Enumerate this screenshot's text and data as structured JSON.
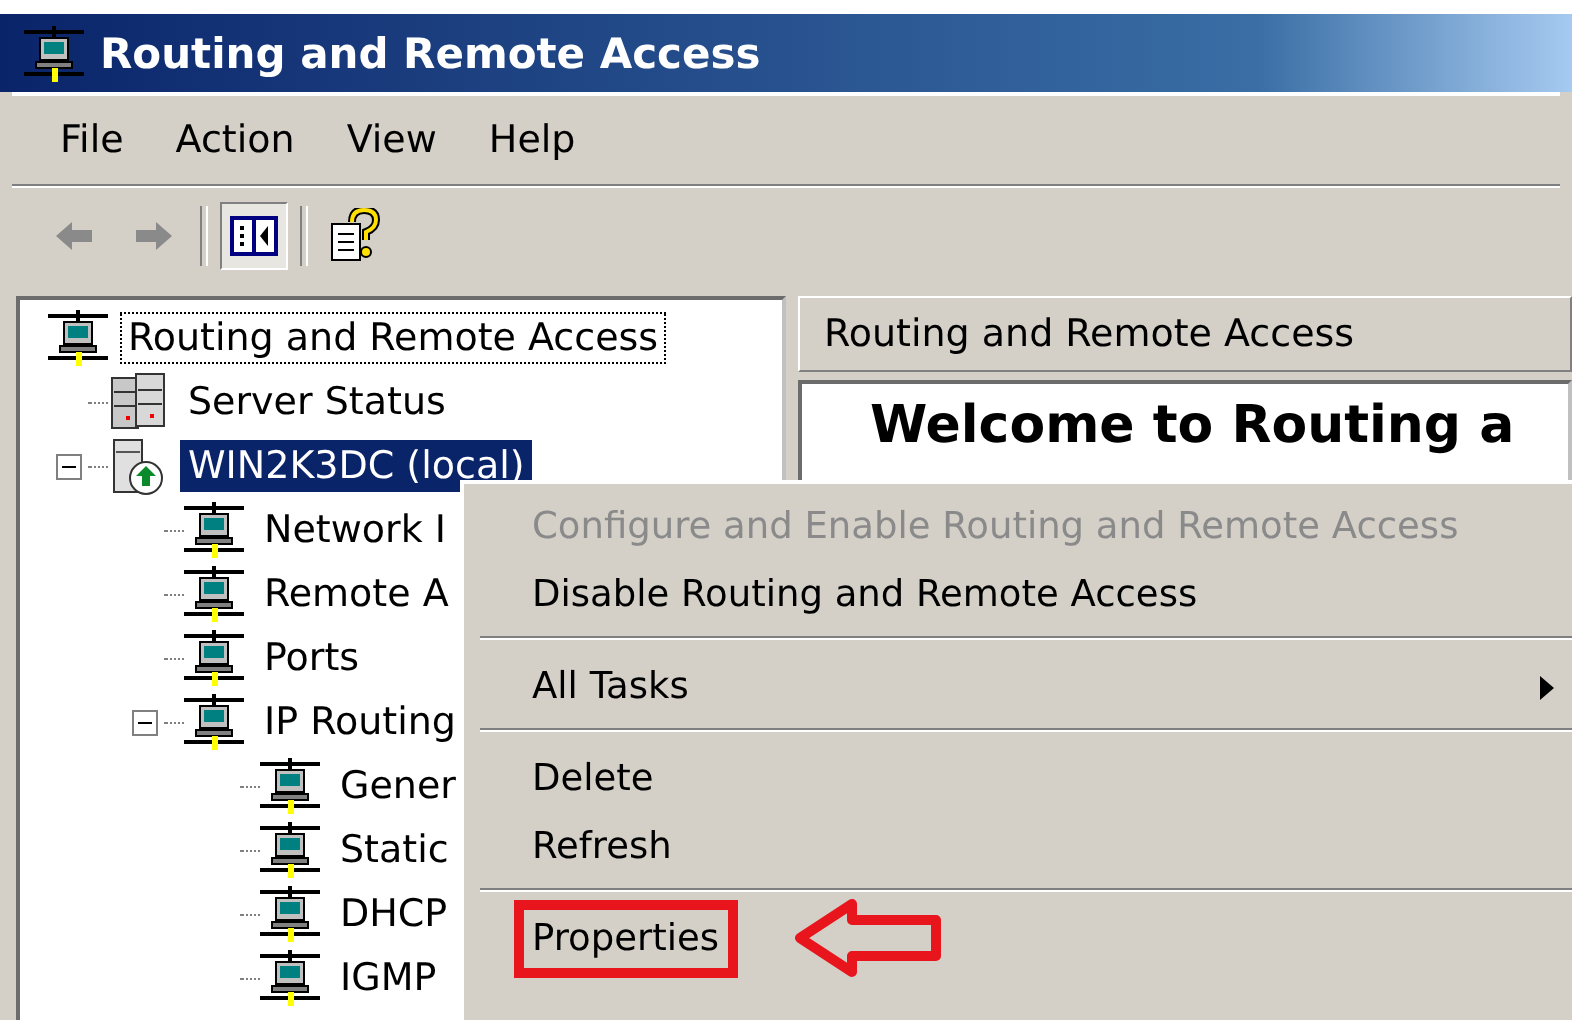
{
  "window": {
    "title": "Routing and Remote Access"
  },
  "menu_bar": [
    {
      "label": "File"
    },
    {
      "label": "Action"
    },
    {
      "label": "View"
    },
    {
      "label": "Help"
    }
  ],
  "toolbar": [
    {
      "kind": "back",
      "disabled": true
    },
    {
      "kind": "forward",
      "disabled": true
    },
    {
      "kind": "separator"
    },
    {
      "kind": "tree-toggle",
      "pressed": true
    },
    {
      "kind": "separator"
    },
    {
      "kind": "help"
    }
  ],
  "tree": [
    {
      "label": "Routing and Remote Access",
      "kind": "node",
      "selected": false,
      "focused": true,
      "children": [
        {
          "label": "Server Status",
          "kind": "status",
          "selected": false,
          "focused": false
        },
        {
          "label": "WIN2K3DC (local)",
          "kind": "server",
          "selected": true,
          "focused": false,
          "expanded": true,
          "children": [
            {
              "label": "Network I",
              "kind": "node",
              "selected": false,
              "focused": false
            },
            {
              "label": "Remote A",
              "kind": "node",
              "selected": false,
              "focused": false
            },
            {
              "label": "Ports",
              "kind": "node",
              "selected": false,
              "focused": false
            },
            {
              "label": "IP Routing",
              "kind": "node",
              "selected": false,
              "focused": false,
              "expanded": true,
              "children": [
                {
                  "label": "Gener",
                  "kind": "node",
                  "selected": false,
                  "focused": false
                },
                {
                  "label": "Static",
                  "kind": "node",
                  "selected": false,
                  "focused": false
                },
                {
                  "label": "DHCP",
                  "kind": "node",
                  "selected": false,
                  "focused": false
                },
                {
                  "label": "IGMP",
                  "kind": "node",
                  "selected": false,
                  "focused": false
                }
              ]
            }
          ]
        }
      ]
    }
  ],
  "details": {
    "header": "Routing and Remote Access",
    "heading": "Welcome to Routing a"
  },
  "context_menu": [
    {
      "kind": "item",
      "label": "Configure and Enable Routing and Remote Access",
      "disabled": true,
      "submenu": false,
      "annotated": false
    },
    {
      "kind": "item",
      "label": "Disable Routing and Remote Access",
      "disabled": false,
      "submenu": false,
      "annotated": false
    },
    {
      "kind": "separator"
    },
    {
      "kind": "item",
      "label": "All Tasks",
      "disabled": false,
      "submenu": true,
      "annotated": false
    },
    {
      "kind": "separator"
    },
    {
      "kind": "item",
      "label": "Delete",
      "disabled": false,
      "submenu": false,
      "annotated": false
    },
    {
      "kind": "item",
      "label": "Refresh",
      "disabled": false,
      "submenu": false,
      "annotated": false
    },
    {
      "kind": "separator"
    },
    {
      "kind": "item",
      "label": "Properties",
      "disabled": false,
      "submenu": false,
      "annotated": true
    }
  ]
}
